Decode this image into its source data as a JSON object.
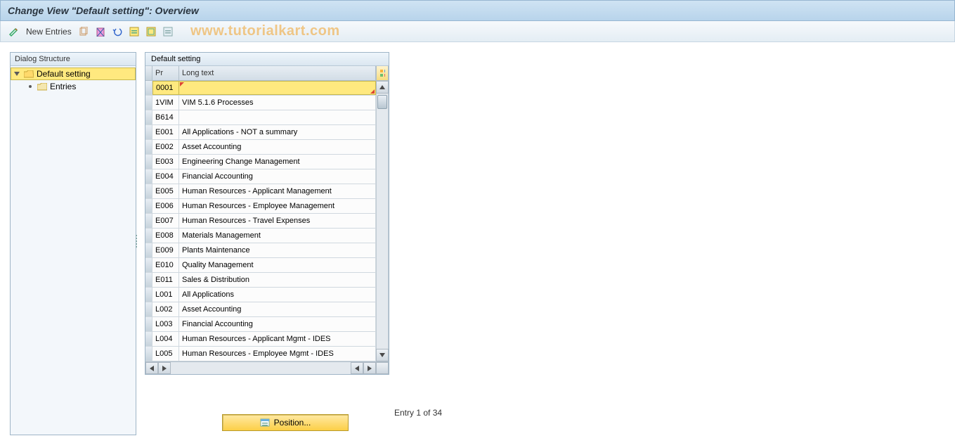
{
  "title": "Change View \"Default setting\": Overview",
  "toolbar": {
    "new_entries_label": "New Entries"
  },
  "watermark_text": "www.tutorialkart.com",
  "dialog_structure": {
    "header": "Dialog Structure",
    "root_label": "Default setting",
    "child_label": "Entries"
  },
  "grid": {
    "title": "Default setting",
    "col_pr": "Pr",
    "col_long": "Long text",
    "rows": [
      {
        "pr": "0001",
        "long": "",
        "editing": true
      },
      {
        "pr": "1VIM",
        "long": "VIM 5.1.6 Processes"
      },
      {
        "pr": "B614",
        "long": ""
      },
      {
        "pr": "E001",
        "long": "All Applications - NOT a summary"
      },
      {
        "pr": "E002",
        "long": "Asset Accounting"
      },
      {
        "pr": "E003",
        "long": "Engineering Change Management"
      },
      {
        "pr": "E004",
        "long": "Financial Accounting"
      },
      {
        "pr": "E005",
        "long": "Human Resources - Applicant Management"
      },
      {
        "pr": "E006",
        "long": "Human Resources - Employee Management"
      },
      {
        "pr": "E007",
        "long": "Human Resources - Travel Expenses"
      },
      {
        "pr": "E008",
        "long": "Materials Management"
      },
      {
        "pr": "E009",
        "long": "Plants Maintenance"
      },
      {
        "pr": "E010",
        "long": "Quality Management"
      },
      {
        "pr": "E011",
        "long": "Sales & Distribution"
      },
      {
        "pr": "L001",
        "long": "All Applications"
      },
      {
        "pr": "L002",
        "long": "Asset Accounting"
      },
      {
        "pr": "L003",
        "long": "Financial Accounting"
      },
      {
        "pr": "L004",
        "long": "Human Resources - Applicant Mgmt - IDES"
      },
      {
        "pr": "L005",
        "long": "Human Resources - Employee Mgmt - IDES"
      }
    ]
  },
  "position_button_label": "Position...",
  "entry_status": "Entry 1 of 34"
}
